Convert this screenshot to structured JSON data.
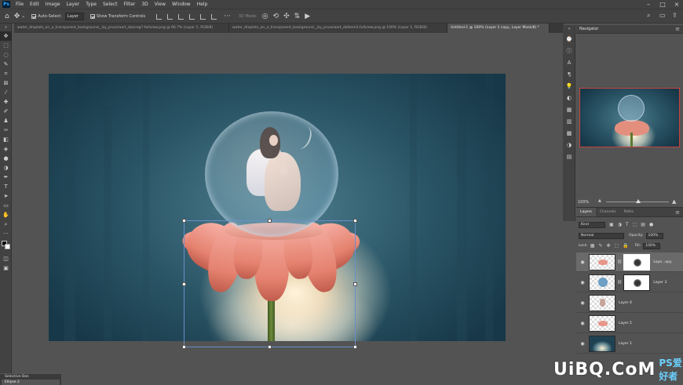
{
  "menubar": {
    "logo": "Ps",
    "items": [
      "File",
      "Edit",
      "Image",
      "Layer",
      "Type",
      "Select",
      "Filter",
      "3D",
      "View",
      "Window",
      "Help"
    ]
  },
  "options": {
    "auto_select_label": "Auto-Select:",
    "auto_select_value": "Layer",
    "show_transform_label": "Show Transform Controls",
    "mode_label": "3D Mode:"
  },
  "tabs": [
    {
      "label": "water_droplets_on_a_transparent_background__by_prussiaart_daoceg7-fullview.png @ 66.7% (Layer 1, RGB/8)",
      "active": false
    },
    {
      "label": "water_droplets_on_a_transparent_background__by_prussiaart_dafzem1-fullview.png @ 100% (Layer 1, RGB/8)",
      "active": false
    },
    {
      "label": "Untitled-1 @ 100% (Layer 2 copy, Layer Mask/8) *",
      "active": true
    }
  ],
  "navigator": {
    "title": "Navigator",
    "zoom": "100%"
  },
  "layers": {
    "tabs": [
      "Layers",
      "Channels",
      "Paths"
    ],
    "filter_kind": "Kind",
    "blend_mode": "Normal",
    "opacity_label": "Opacity:",
    "opacity_value": "100%",
    "lock_label": "Lock:",
    "fill_label": "Fill:",
    "fill_value": "100%",
    "items": [
      {
        "name": "Laye...opy",
        "active": true
      },
      {
        "name": "Layer 3",
        "active": false
      },
      {
        "name": "Layer 4",
        "active": false
      },
      {
        "name": "Layer 2",
        "active": false
      },
      {
        "name": "Layer 1",
        "active": false
      }
    ]
  },
  "mini_panel": {
    "title": "Selective Ban",
    "sub": "Ellipse 2"
  },
  "watermark": {
    "main": "UiBQ.CoM",
    "sub": "PS爱好者"
  }
}
